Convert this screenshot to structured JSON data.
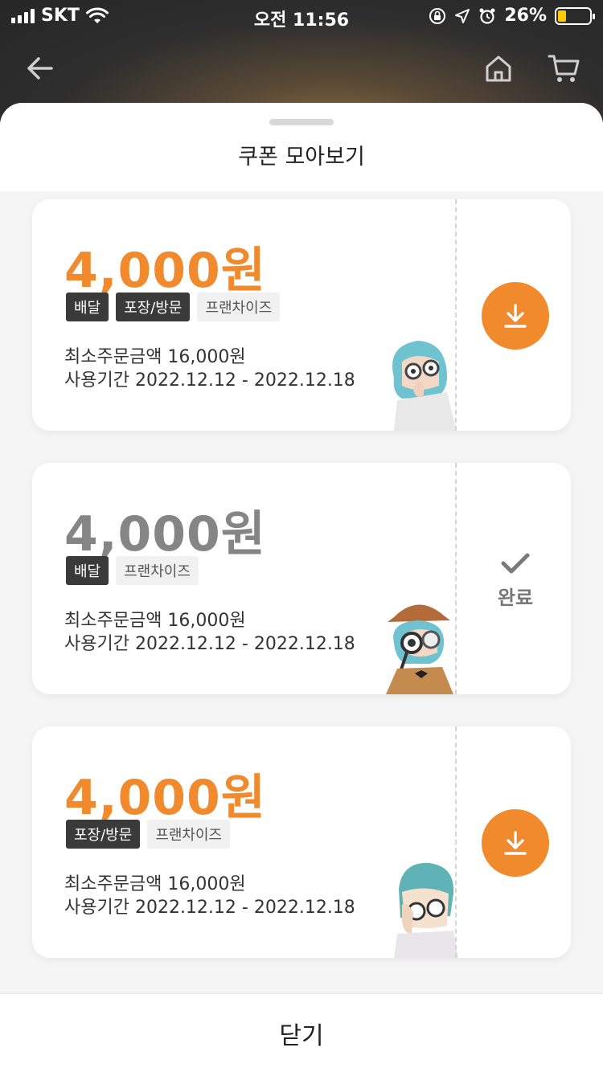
{
  "status_bar": {
    "carrier": "SKT",
    "time": "오전 11:56",
    "battery_percent": "26%",
    "battery_level": 0.26
  },
  "nav": {
    "back_icon": "arrow-left-icon",
    "home_icon": "home-icon",
    "cart_icon": "cart-icon"
  },
  "sheet": {
    "title": "쿠폰 모아보기"
  },
  "coupons": [
    {
      "amount": "4,000원",
      "tags": [
        "배달",
        "포장/방문",
        "프랜차이즈"
      ],
      "min_order": "최소주문금액 16,000원",
      "period": "사용기간 2022.12.12 - 2022.12.18",
      "state": "download"
    },
    {
      "amount": "4,000원",
      "tags": [
        "배달",
        "프랜차이즈"
      ],
      "min_order": "최소주문금액 16,000원",
      "period": "사용기간 2022.12.12 - 2022.12.18",
      "state": "done",
      "done_label": "완료"
    },
    {
      "amount": "4,000원",
      "tags": [
        "포장/방문",
        "프랜차이즈"
      ],
      "min_order": "최소주문금액 16,000원",
      "period": "사용기간 2022.12.12 - 2022.12.18",
      "state": "download"
    }
  ],
  "bottom": {
    "close_label": "닫기"
  },
  "colors": {
    "accent": "#f08a2c",
    "tag_dark": "#3a3a3a",
    "tag_light": "#f1f1f1",
    "disabled_amount": "#858585"
  }
}
